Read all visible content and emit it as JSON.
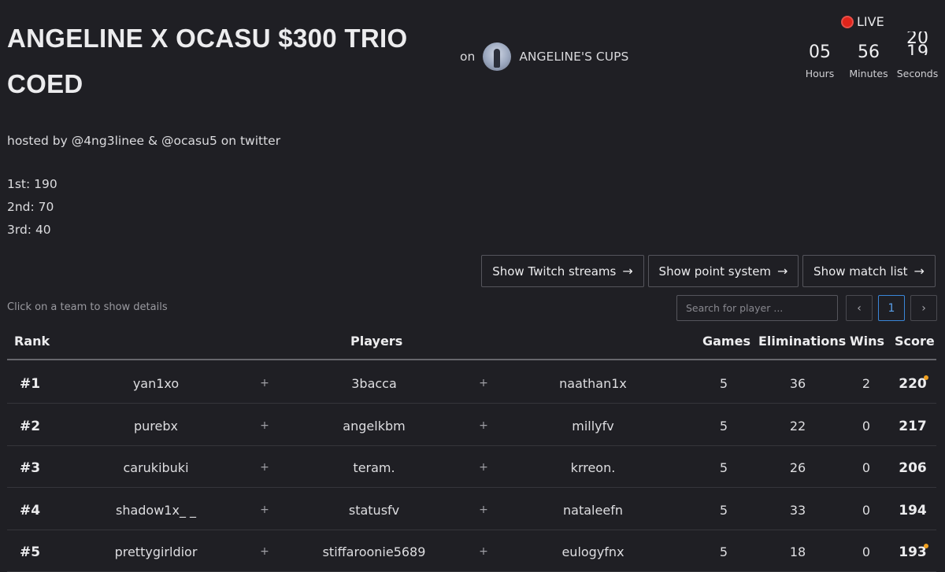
{
  "tournament": {
    "title": "ANGELINE X OCASU $300 TRIO COED",
    "on_label": "on",
    "organizer": "ANGELINE'S CUPS",
    "host_text": "hosted by @4ng3linee & @ocasu5 on twitter",
    "prizes": [
      "1st: 190",
      "2nd: 70",
      "3rd: 40"
    ]
  },
  "status": {
    "live_label": "LIVE",
    "live_color": "#e0241b",
    "countdown": {
      "hours": "05",
      "hours_label": "Hours",
      "minutes": "56",
      "minutes_label": "Minutes",
      "seconds_top": "20",
      "seconds_bottom": "19",
      "seconds_label": "Seconds"
    }
  },
  "actions": {
    "twitch": "Show Twitch streams",
    "points": "Show point system",
    "matches": "Show match list"
  },
  "hint": "Click on a team to show details",
  "search": {
    "placeholder": "Search for player ..."
  },
  "pagination": {
    "prev": "‹",
    "current": "1",
    "next": "›"
  },
  "table": {
    "headers": {
      "rank": "Rank",
      "players": "Players",
      "games": "Games",
      "eliminations": "Eliminations",
      "wins": "Wins",
      "score": "Score"
    },
    "plus": "+",
    "rows": [
      {
        "rank": "#1",
        "p1": "yan1xo",
        "p2": "3bacca",
        "p3": "naathan1x",
        "games": "5",
        "elims": "36",
        "wins": "2",
        "score": "220",
        "flag": true
      },
      {
        "rank": "#2",
        "p1": "purebx",
        "p2": "angelkbm",
        "p3": "millyfv",
        "games": "5",
        "elims": "22",
        "wins": "0",
        "score": "217",
        "flag": false
      },
      {
        "rank": "#3",
        "p1": "carukibuki",
        "p2": "teram.",
        "p3": "krreon.",
        "games": "5",
        "elims": "26",
        "wins": "0",
        "score": "206",
        "flag": false
      },
      {
        "rank": "#4",
        "p1": "shadow1x_ _",
        "p2": "statusfv",
        "p3": "nataleefn",
        "games": "5",
        "elims": "33",
        "wins": "0",
        "score": "194",
        "flag": false
      },
      {
        "rank": "#5",
        "p1": "prettygirldior",
        "p2": "stiffaroonie5689",
        "p3": "eulogyfnx",
        "games": "5",
        "elims": "18",
        "wins": "0",
        "score": "193",
        "flag": true
      }
    ]
  }
}
